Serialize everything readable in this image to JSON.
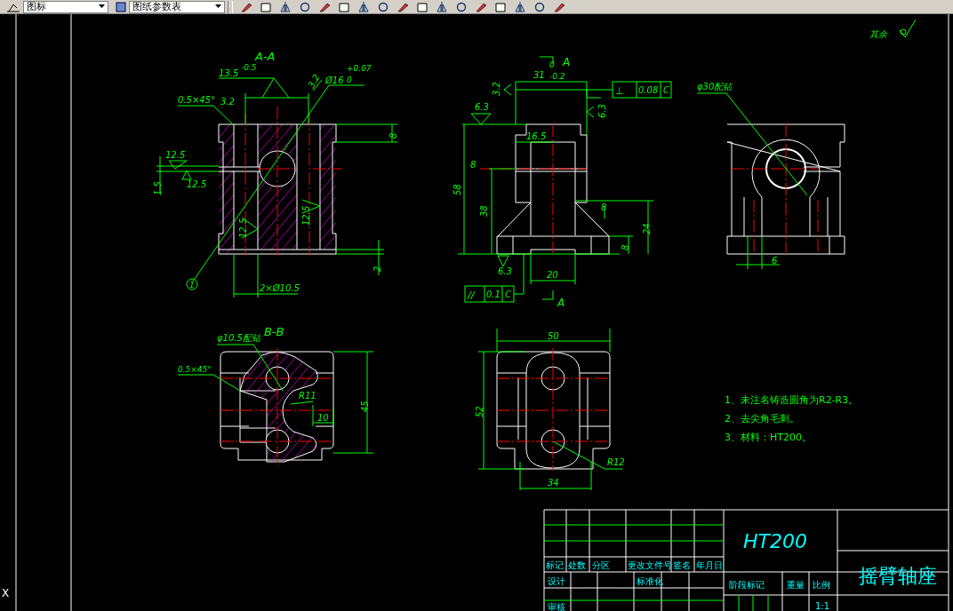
{
  "toolbar": {
    "layer_dropdown": {
      "value": "图标"
    },
    "style_dropdown": {
      "value": "图纸参数表"
    }
  },
  "ucs_label": "X",
  "annotations": [
    {
      "kind": "view-label",
      "text": "A-A"
    },
    {
      "kind": "dimension",
      "text": "13.5"
    },
    {
      "kind": "tolerance",
      "text": "-0.5"
    },
    {
      "kind": "roughness",
      "text": "3.2"
    },
    {
      "kind": "dimension",
      "text": "Ø16"
    },
    {
      "kind": "tolerance",
      "text": "+0.07"
    },
    {
      "kind": "tolerance",
      "text": "0"
    },
    {
      "kind": "dimension",
      "text": "0.5×45°"
    },
    {
      "kind": "roughness",
      "text": "3.2"
    },
    {
      "kind": "roughness",
      "text": "12.5"
    },
    {
      "kind": "roughness",
      "text": "12.5"
    },
    {
      "kind": "dimension",
      "text": "1.5"
    },
    {
      "kind": "dimension",
      "text": "8"
    },
    {
      "kind": "roughness",
      "text": "12.5"
    },
    {
      "kind": "roughness",
      "text": "12.5"
    },
    {
      "kind": "dimension",
      "text": "2"
    },
    {
      "kind": "dimension",
      "text": "2×Ø10.5"
    },
    {
      "kind": "balloon",
      "text": "1"
    },
    {
      "kind": "section-mark",
      "text": "A"
    },
    {
      "kind": "dimension",
      "text": "31"
    },
    {
      "kind": "tolerance",
      "text": "0"
    },
    {
      "kind": "tolerance",
      "text": "-0.2"
    },
    {
      "kind": "roughness",
      "text": "3.2"
    },
    {
      "kind": "roughness",
      "text": "6.3"
    },
    {
      "kind": "roughness",
      "text": "6.3"
    },
    {
      "kind": "dimension",
      "text": "16.5"
    },
    {
      "kind": "dimension",
      "text": "8"
    },
    {
      "kind": "dimension",
      "text": "58"
    },
    {
      "kind": "dimension",
      "text": "38"
    },
    {
      "kind": "dimension",
      "text": "8"
    },
    {
      "kind": "dimension",
      "text": "24"
    },
    {
      "kind": "dimension",
      "text": "8"
    },
    {
      "kind": "roughness",
      "text": "6.3"
    },
    {
      "kind": "dimension",
      "text": "20"
    },
    {
      "kind": "section-mark",
      "text": "A"
    },
    {
      "kind": "roughness",
      "text": "其余"
    },
    {
      "kind": "dimension",
      "text": "φ30配钻"
    },
    {
      "kind": "dimension",
      "text": "6"
    },
    {
      "kind": "view-label",
      "text": "B-B"
    },
    {
      "kind": "dimension",
      "text": "φ10.5配钻"
    },
    {
      "kind": "tolerance",
      "text": "0.5×45°"
    },
    {
      "kind": "dimension",
      "text": "R11"
    },
    {
      "kind": "dimension",
      "text": "10"
    },
    {
      "kind": "dimension",
      "text": "45"
    },
    {
      "kind": "dimension",
      "text": "50"
    },
    {
      "kind": "dimension",
      "text": "52"
    },
    {
      "kind": "dimension",
      "text": "R12"
    },
    {
      "kind": "dimension",
      "text": "34"
    }
  ],
  "tolerance_frames": [
    {
      "symbol": "⊥",
      "value": "0.08",
      "datum": "C"
    },
    {
      "symbol": "//",
      "value": "0.1",
      "datum": "C"
    }
  ],
  "notes": [
    "1、未注名铸造圆角为R2-R3。",
    "2、去尖角毛刺。",
    "3、材料：HT200。"
  ],
  "title_block": {
    "revision_headers": [
      "标记",
      "处数",
      "分区",
      "更改文件号",
      "签名",
      "年月日"
    ],
    "sign_labels": [
      "设计",
      "标准化",
      "审核"
    ],
    "material": "HT200",
    "part_name": "摇臂轴座",
    "info_headers": [
      "阶段标记",
      "重量",
      "比例"
    ],
    "scale": "1:1"
  }
}
